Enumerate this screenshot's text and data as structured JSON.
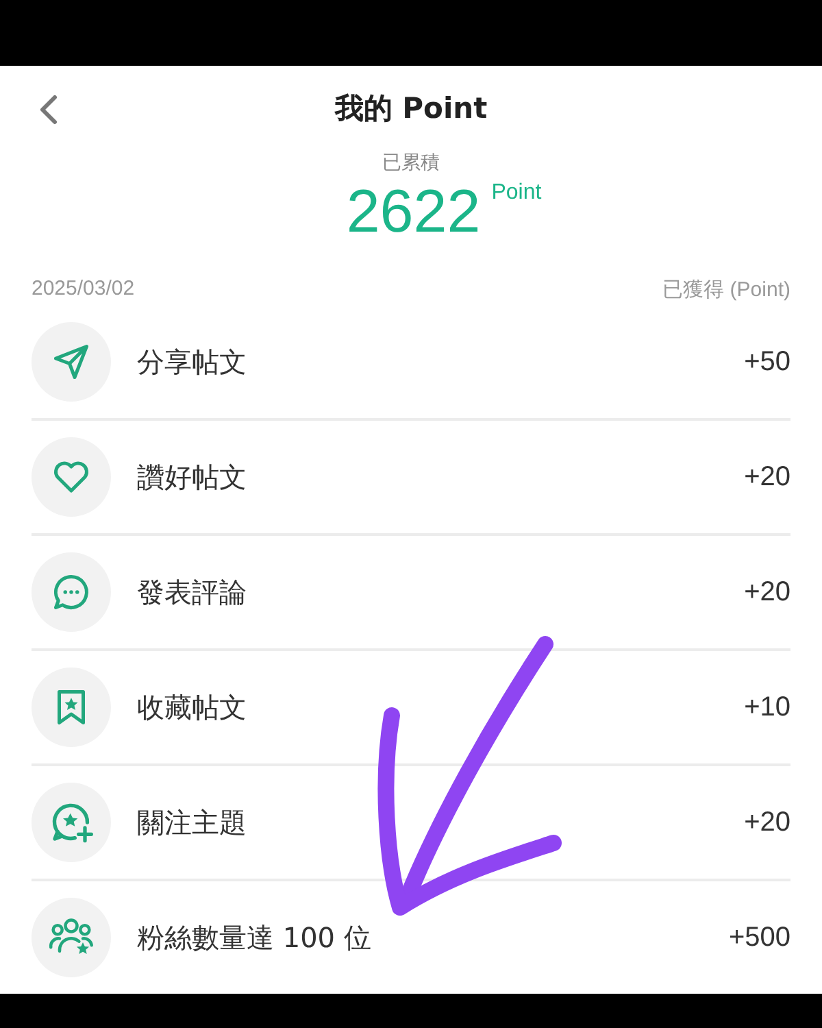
{
  "header": {
    "title": "我的 Point"
  },
  "summary": {
    "label": "已累積",
    "total": "2622",
    "unit": "Point"
  },
  "list_header": {
    "date": "2025/03/02",
    "column": "已獲得 (Point)"
  },
  "items": [
    {
      "kind": "share",
      "label": "分享帖文",
      "points": "+50"
    },
    {
      "kind": "like",
      "label": "讚好帖文",
      "points": "+20"
    },
    {
      "kind": "comment",
      "label": "發表評論",
      "points": "+20"
    },
    {
      "kind": "bookmark",
      "label": "收藏帖文",
      "points": "+10"
    },
    {
      "kind": "follow",
      "label": "關注主題",
      "points": "+20"
    },
    {
      "kind": "fans",
      "label": "粉絲數量達 100 位",
      "points": "+500"
    }
  ],
  "annotation": {
    "kind": "arrow"
  }
}
